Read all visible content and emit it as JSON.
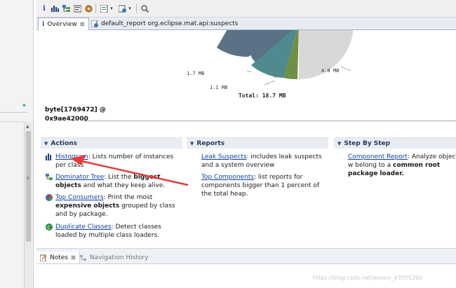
{
  "toolbar": {
    "icons": [
      "info-icon",
      "histogram-icon",
      "dominator-tree-icon",
      "query-icon",
      "heap-dump-icon",
      "reports-icon",
      "dropdown-icon",
      "run-report-icon",
      "dropdown-icon",
      "search-icon"
    ]
  },
  "tabs": [
    {
      "label": "Overview",
      "active": true
    },
    {
      "label": "default_report  org.eclipse.mat.api:suspects",
      "active": false
    }
  ],
  "pie": {
    "labels": {
      "slice_a": "1.7 MB",
      "slice_b": "1.1 MB",
      "slice_c": "4.8 MB"
    },
    "total": "Total: 18.7 MB"
  },
  "object": {
    "name": "byte[1769472] @",
    "address": "0x9ae42000"
  },
  "sections": {
    "actions": "Actions",
    "reports": "Reports",
    "step_by_step": "Step By Step"
  },
  "actions": {
    "histogram": {
      "link": "Histogram",
      "text": ": Lists number of instances per class"
    },
    "dominator": {
      "link": "Dominator Tree",
      "pre": ": List the ",
      "bold": "biggest objects",
      "post": " and what they keep alive."
    },
    "consumers": {
      "link": "Top Consumers",
      "pre": ": Print the most ",
      "bold": "expensive objects",
      "post": " grouped by class and by package."
    },
    "duplicates": {
      "link": "Duplicate Classes",
      "text": ": Detect classes loaded by multiple class loaders."
    }
  },
  "reports": {
    "leak": {
      "link": "Leak Suspects",
      "text": ": includes leak suspects and a system overview"
    },
    "components": {
      "link": "Top Components",
      "text": ": list reports for components bigger than 1 percent of the total heap."
    }
  },
  "steps": {
    "component": {
      "link": "Component Report",
      "pre": ": Analyze objects w",
      "mid": " belong to a ",
      "bold": "common root package",
      "post": " ",
      "tail": "loader."
    }
  },
  "bottom_tabs": {
    "notes": "Notes",
    "navigation": "Navigation History"
  },
  "watermark": "https://blog.csdn.net/weixin_43505260",
  "colors": {
    "pie_slate": "#5b7185",
    "pie_teal": "#4f8a8f",
    "pie_green": "#6f8f45",
    "pie_grey": "#d8d8d8",
    "link": "#0f3fa6",
    "arrow": "#e43b3b"
  }
}
